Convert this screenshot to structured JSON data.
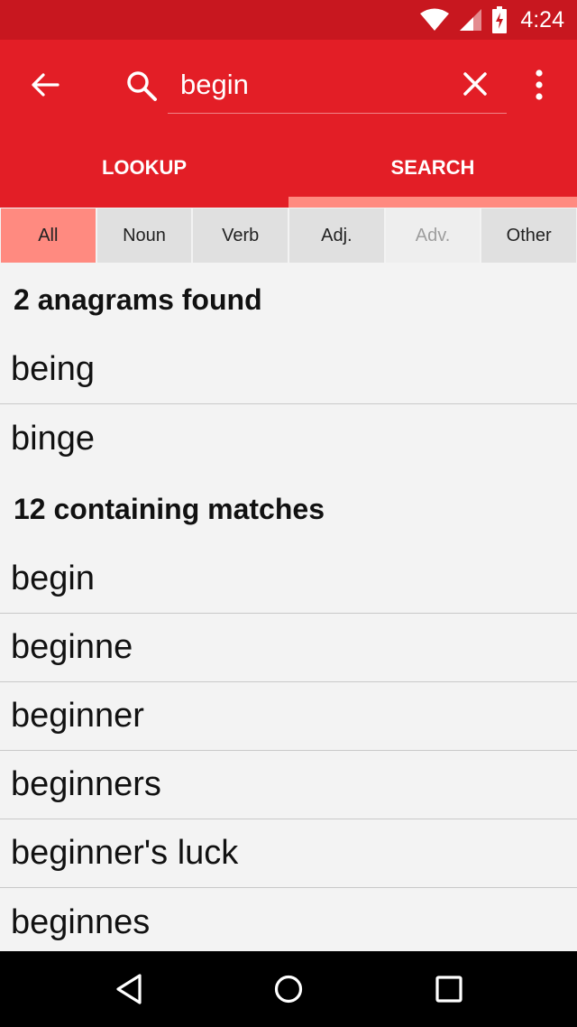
{
  "status_bar": {
    "time": "4:24",
    "icons": [
      "wifi-icon",
      "signal-icon",
      "battery-charging-icon"
    ]
  },
  "toolbar": {
    "search_value": "begin",
    "icons": [
      "back-arrow-icon",
      "search-icon",
      "clear-icon",
      "more-vert-icon"
    ],
    "tabs": [
      {
        "label": "LOOKUP",
        "selected": false
      },
      {
        "label": "SEARCH",
        "selected": true
      }
    ]
  },
  "filters": [
    {
      "label": "All",
      "state": "active"
    },
    {
      "label": "Noun",
      "state": "normal"
    },
    {
      "label": "Verb",
      "state": "normal"
    },
    {
      "label": "Adj.",
      "state": "normal"
    },
    {
      "label": "Adv.",
      "state": "disabled"
    },
    {
      "label": "Other",
      "state": "normal"
    }
  ],
  "results": {
    "anagrams_header": "2 anagrams found",
    "anagrams": [
      "being",
      "binge"
    ],
    "containing_header": "12 containing matches",
    "containing": [
      "begin",
      "beginne",
      "beginner",
      "beginners",
      "beginner's luck",
      "beginnes"
    ]
  },
  "colors": {
    "status_bar": "#c8171f",
    "toolbar": "#e31e26",
    "accent": "#ff8a80"
  },
  "nav_bar": {
    "icons": [
      "nav-back-icon",
      "nav-home-icon",
      "nav-recent-icon"
    ]
  }
}
